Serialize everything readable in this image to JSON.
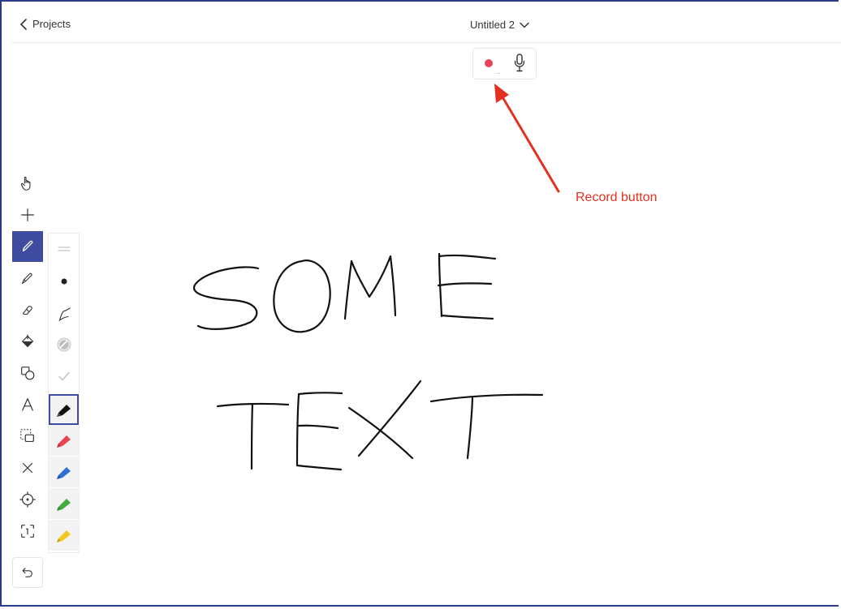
{
  "header": {
    "back_label": "Projects",
    "document_title": "Untitled 2"
  },
  "recorder": {
    "record_label_icon": "record-dot",
    "more_dots": "...",
    "mic_icon": "microphone-icon"
  },
  "annotation": {
    "label": "Record button",
    "color": "#e2321f"
  },
  "toolbar": {
    "tools": [
      {
        "name": "hand-icon"
      },
      {
        "name": "plus-icon"
      },
      {
        "name": "pen-icon",
        "active": true
      },
      {
        "name": "highlighter-icon"
      },
      {
        "name": "eraser-icon"
      },
      {
        "name": "fill-icon"
      },
      {
        "name": "shapes-icon"
      },
      {
        "name": "text-icon"
      },
      {
        "name": "lasso-select-icon"
      },
      {
        "name": "close-icon"
      },
      {
        "name": "laser-pointer-icon"
      },
      {
        "name": "frame-capture-icon"
      }
    ],
    "undo_icon": "undo-icon"
  },
  "pen_panel": {
    "options": [
      "stroke-width-icon",
      "dot-size-icon",
      "pen-stroke-icon",
      "opacity-icon",
      "check-icon"
    ],
    "colors": [
      "#111111",
      "#e8454d",
      "#2f6fd6",
      "#3fae3f",
      "#f2c820"
    ],
    "selected_color_index": 0
  },
  "canvas": {
    "handwriting_line1": "SOME",
    "handwriting_line2": "TEXT"
  },
  "accent_color": "#3f4c9f"
}
